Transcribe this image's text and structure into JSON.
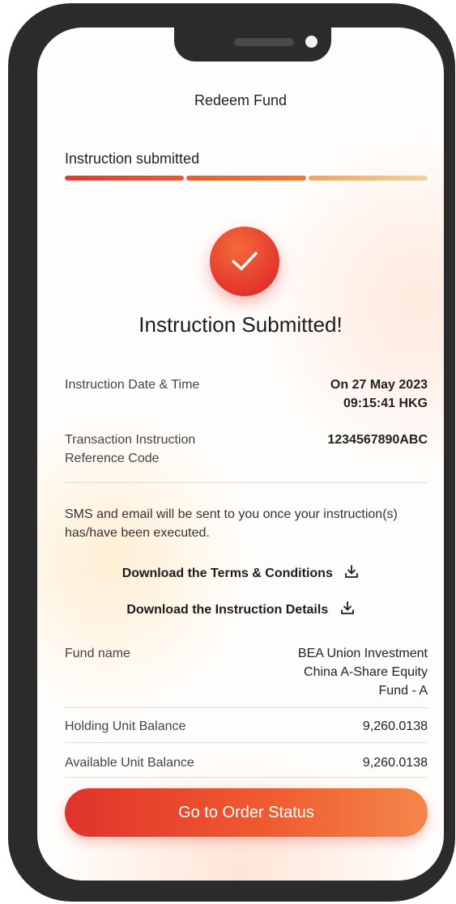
{
  "header": {
    "title": "Redeem Fund"
  },
  "progress": {
    "label": "Instruction submitted",
    "completed_steps": 3,
    "total_steps": 3
  },
  "status": {
    "headline": "Instruction Submitted!"
  },
  "details": {
    "date_label": "Instruction Date & Time",
    "date_value_line1": "On 27 May 2023",
    "date_value_line2": "09:15:41 HKG",
    "ref_label_line1": "Transaction Instruction",
    "ref_label_line2": "Reference Code",
    "ref_value": "1234567890ABC"
  },
  "note": "SMS and email will be sent to you once your instruction(s) has/have been executed.",
  "links": {
    "terms": "Download the Terms & Conditions",
    "details": "Download the Instruction Details"
  },
  "fund": {
    "name_label": "Fund name",
    "name_line1": "BEA Union Investment",
    "name_line2": "China A-Share Equity",
    "name_line3": "Fund - A",
    "holding_label": "Holding Unit Balance",
    "holding_value": "9,260.0138",
    "available_label": "Available Unit Balance",
    "available_value": "9,260.0138"
  },
  "cta": {
    "label": "Go to Order Status"
  },
  "colors": {
    "accent": "#e2322a",
    "accent_light": "#f4874a",
    "frame": "#2b2b2b"
  },
  "icons": {
    "success": "check-icon",
    "download": "download-icon"
  }
}
